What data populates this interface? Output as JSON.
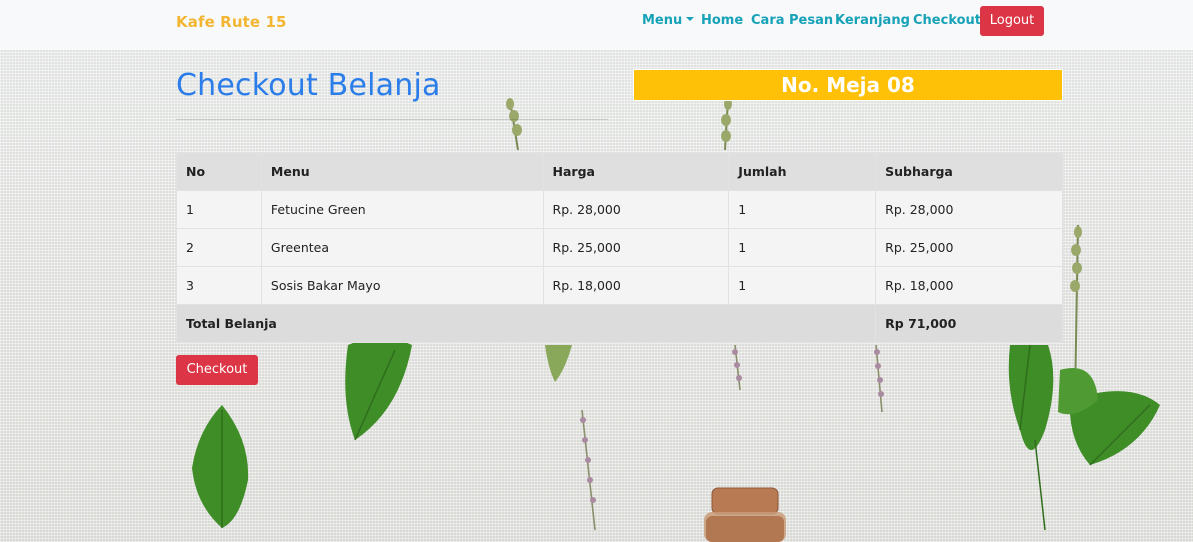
{
  "navbar": {
    "brand": "Kafe Rute 15",
    "menu": "Menu",
    "home": "Home",
    "cara_pesan": "Cara Pesan",
    "keranjang": "Keranjang",
    "checkout": "Checkout",
    "logout": "Logout"
  },
  "page": {
    "title": "Checkout Belanja",
    "table_number": "No. Meja 08"
  },
  "table": {
    "headers": [
      "No",
      "Menu",
      "Harga",
      "Jumlah",
      "Subharga"
    ],
    "rows": [
      [
        "1",
        "Fetucine Green",
        "Rp. 28,000",
        "1",
        "Rp. 28,000"
      ],
      [
        "2",
        "Greentea",
        "Rp. 25,000",
        "1",
        "Rp. 25,000"
      ],
      [
        "3",
        "Sosis Bakar Mayo",
        "Rp. 18,000",
        "1",
        "Rp. 18,000"
      ]
    ],
    "total_label": "Total Belanja",
    "total_value": "Rp 71,000"
  },
  "checkout_button": "Checkout",
  "colors": {
    "brand": "#f2b632",
    "nav_link": "#17a2b8",
    "danger": "#dc3545",
    "badge": "#ffc107",
    "title": "#2b7de9"
  }
}
